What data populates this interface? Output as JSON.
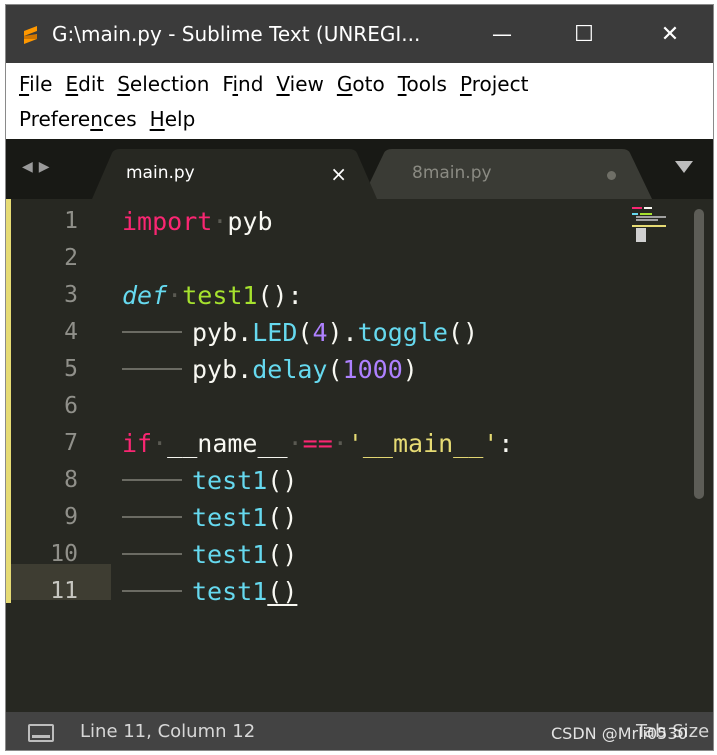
{
  "window": {
    "title": "G:\\main.py - Sublime Text (UNREGI...",
    "controls": {
      "minimize": "—",
      "maximize": "☐",
      "close": "✕"
    }
  },
  "menu": {
    "row1": [
      {
        "pre": "",
        "key": "F",
        "post": "ile"
      },
      {
        "pre": "",
        "key": "E",
        "post": "dit"
      },
      {
        "pre": "",
        "key": "S",
        "post": "election"
      },
      {
        "pre": "F",
        "key": "i",
        "post": "nd"
      },
      {
        "pre": "",
        "key": "V",
        "post": "iew"
      },
      {
        "pre": "",
        "key": "G",
        "post": "oto"
      },
      {
        "pre": "",
        "key": "T",
        "post": "ools"
      },
      {
        "pre": "",
        "key": "P",
        "post": "roject"
      }
    ],
    "row2": [
      {
        "pre": "Prefere",
        "key": "n",
        "post": "ces"
      },
      {
        "pre": "",
        "key": "H",
        "post": "elp"
      }
    ]
  },
  "tabs": [
    {
      "label": "main.py",
      "active": true,
      "close": "×"
    },
    {
      "label": "8main.py",
      "active": false,
      "modified": true
    }
  ],
  "editor": {
    "line_numbers": [
      "1",
      "2",
      "3",
      "4",
      "5",
      "6",
      "7",
      "8",
      "9",
      "10",
      "11"
    ],
    "current_line": "11",
    "lines": {
      "l1": {
        "kw": "import",
        "ws": "·",
        "name": "pyb"
      },
      "l3": {
        "def": "def",
        "ws": "·",
        "fn": "test1",
        "rest": "():"
      },
      "l4": {
        "a": "pyb.",
        "b": "LED",
        "c": "(",
        "d": "4",
        "e": ").",
        "f": "toggle",
        "g": "()"
      },
      "l5": {
        "a": "pyb.",
        "b": "delay",
        "c": "(",
        "d": "1000",
        "e": ")"
      },
      "l7": {
        "kw": "if",
        "ws1": "·",
        "name": "__name__",
        "ws2": "·",
        "op": "==",
        "ws3": "·",
        "str": "'__main__'",
        "rest": ":"
      },
      "l8": {
        "call": "test1",
        "rest": "()"
      },
      "l9": {
        "call": "test1",
        "rest": "()"
      },
      "l10": {
        "call": "test1",
        "rest": "()"
      },
      "l11": {
        "call": "test1",
        "rest": "()"
      }
    }
  },
  "status": {
    "position": "Line 11, Column 12",
    "tab_size": "Tab Size",
    "watermark": "CSDN @Mrli0530"
  },
  "colors": {
    "background": "#272822",
    "keyword": "#f92672",
    "function": "#a6e22e",
    "builtin": "#66d9ef",
    "number": "#ae81ff",
    "string": "#e6db74"
  },
  "icons": {
    "app": "sublime-text-icon",
    "nav": "tab-navigation-arrows-icon",
    "dropdown": "tab-list-dropdown-icon",
    "panel": "panel-toggle-icon"
  }
}
